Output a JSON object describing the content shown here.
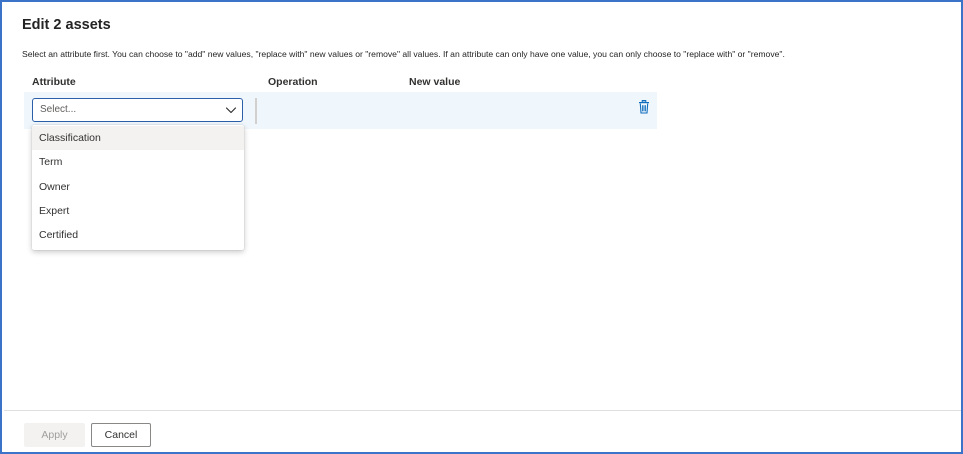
{
  "dialog": {
    "title": "Edit 2 assets",
    "description": "Select an attribute first. You can choose to \"add\" new values, \"replace with\" new values or \"remove\" all values. If an attribute can only have one value, you can only choose to \"replace with\" or \"remove\"."
  },
  "table": {
    "headers": [
      "Attribute",
      "Operation",
      "New value"
    ]
  },
  "attribute_select": {
    "placeholder": "Select...",
    "options": [
      "Classification",
      "Term",
      "Owner",
      "Expert",
      "Certified"
    ]
  },
  "icons": {
    "chevron": "chevron-down-icon",
    "delete": "trash-icon"
  },
  "footer": {
    "apply_label": "Apply",
    "cancel_label": "Cancel"
  },
  "colors": {
    "border_accent": "#3b73c9",
    "row_highlight": "#eff6fc",
    "icon_blue": "#0f6cbd",
    "option_hover": "#f3f2f1"
  }
}
